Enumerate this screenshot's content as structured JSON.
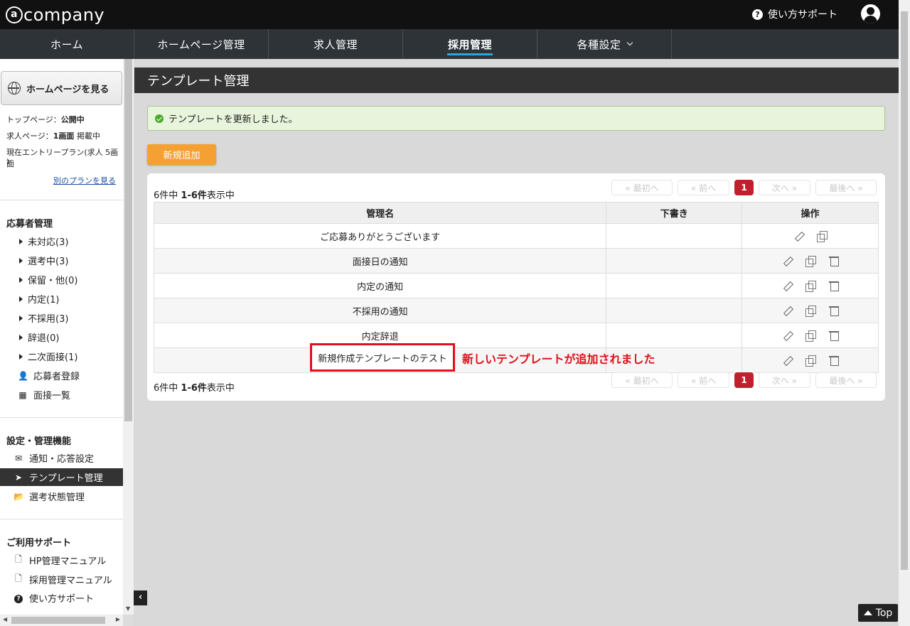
{
  "header": {
    "logo_text": "company",
    "support_label": "使い方サポート"
  },
  "nav": {
    "items": [
      {
        "label": "ホーム"
      },
      {
        "label": "ホームページ管理"
      },
      {
        "label": "求人管理"
      },
      {
        "label": "採用管理",
        "active": true
      },
      {
        "label": "各種設定",
        "dropdown": true
      }
    ]
  },
  "sidebar": {
    "home_button": "ホームページを見る",
    "info": {
      "top_page_label": "トップページ：",
      "top_page_value": "公開中",
      "job_page_label": "求人ページ：",
      "job_page_value": "1画面",
      "job_page_suffix": " 掲載中",
      "plan_line1": "現在エントリープラン(求人 5画面",
      "plan_line2": ")",
      "other_plan_link": "別のプランを見る"
    },
    "applicant_section": {
      "title": "応募者管理",
      "items": [
        {
          "label": "未対応(3)"
        },
        {
          "label": "選考中(3)"
        },
        {
          "label": "保留・他(0)"
        },
        {
          "label": "内定(1)"
        },
        {
          "label": "不採用(3)"
        },
        {
          "label": "辞退(0)"
        },
        {
          "label": "二次面接(1)"
        }
      ],
      "register_label": "応募者登録",
      "interview_label": "面接一覧"
    },
    "settings_section": {
      "title": "設定・管理機能",
      "items": [
        {
          "label": "通知・応答設定",
          "icon": "envelope-icon"
        },
        {
          "label": "テンプレート管理",
          "icon": "paper-plane-icon",
          "active": true
        },
        {
          "label": "選考状態管理",
          "icon": "folder-open-icon"
        }
      ]
    },
    "support_section": {
      "title": "ご利用サポート",
      "items": [
        {
          "label": "HP管理マニュアル",
          "icon": "pdf-icon"
        },
        {
          "label": "採用管理マニュアル",
          "icon": "pdf-icon"
        },
        {
          "label": "使い方サポート",
          "icon": "question-circle-icon"
        }
      ]
    }
  },
  "main": {
    "title": "テンプレート管理",
    "alert": "テンプレートを更新しました。",
    "new_button": "新規追加",
    "count_prefix": "6件中 ",
    "count_bold": "1-6件",
    "count_suffix": "表示中",
    "pager": {
      "first": "« 最初へ",
      "prev": "« 前へ",
      "current": "1",
      "next": "次へ »",
      "last": "最後へ »"
    },
    "table": {
      "headers": [
        "管理名",
        "下書き",
        "操作"
      ],
      "rows": [
        {
          "name": "ご応募ありがとうございます",
          "draft": "",
          "deletable": false
        },
        {
          "name": "面接日の通知",
          "draft": "",
          "deletable": true
        },
        {
          "name": "内定の通知",
          "draft": "",
          "deletable": true
        },
        {
          "name": "不採用の通知",
          "draft": "",
          "deletable": true
        },
        {
          "name": "内定辞退",
          "draft": "",
          "deletable": true
        },
        {
          "name": "新規作成テンプレートのテスト",
          "draft": "",
          "deletable": true
        }
      ]
    },
    "annotation": "新しいテンプレートが追加されました"
  },
  "top_button": "Top",
  "colors": {
    "accent_blue": "#2aa7e0",
    "orange": "#f5a032",
    "pager_active": "#c0202e",
    "annotation_red": "#e0101a",
    "alert_green": "#4caa2a"
  }
}
